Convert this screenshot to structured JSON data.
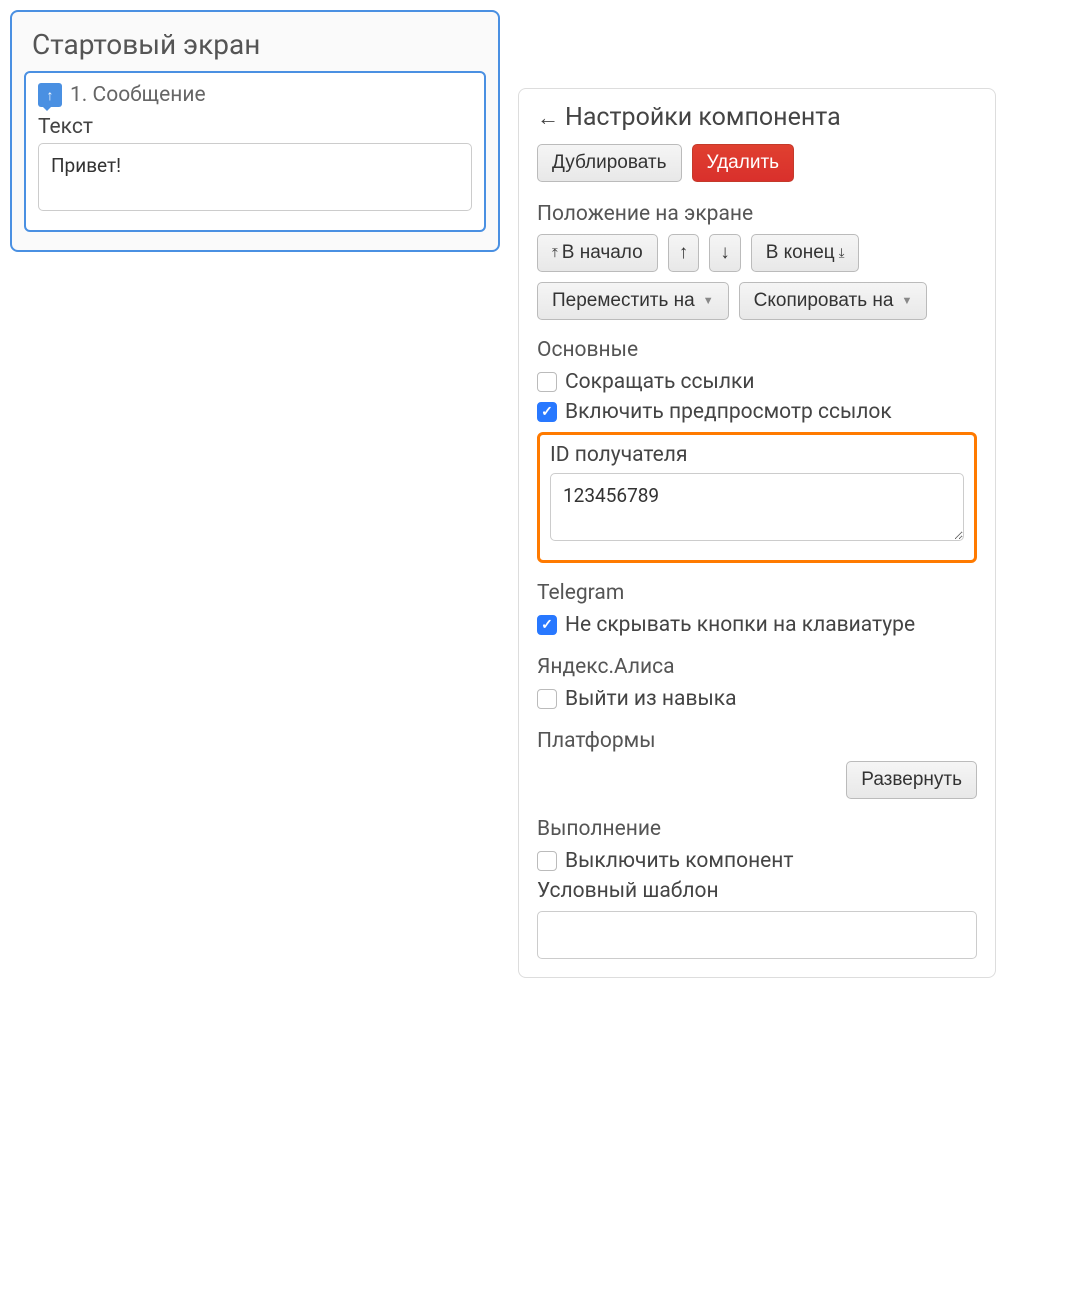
{
  "left": {
    "screen_title": "Стартовый экран",
    "component_title": "1. Сообщение",
    "text_label": "Текст",
    "text_value": "Привет!"
  },
  "settings": {
    "header": "Настройки компонента",
    "duplicate": "Дублировать",
    "delete": "Удалить",
    "position": {
      "title": "Положение на экране",
      "to_start": "В начало",
      "up": "↑",
      "down": "↓",
      "to_end": "В конец",
      "move_to": "Переместить на",
      "copy_to": "Скопировать на"
    },
    "main": {
      "title": "Основные",
      "shorten_links": "Сокращать ссылки",
      "shorten_links_checked": false,
      "enable_preview": "Включить предпросмотр ссылок",
      "enable_preview_checked": true,
      "recipient_id_label": "ID получателя",
      "recipient_id_value": "123456789"
    },
    "telegram": {
      "title": "Telegram",
      "keep_buttons": "Не скрывать кнопки на клавиатуре",
      "keep_buttons_checked": true
    },
    "alisa": {
      "title": "Яндекс.Алиса",
      "exit_skill": "Выйти из навыка",
      "exit_skill_checked": false
    },
    "platforms": {
      "title": "Платформы",
      "expand": "Развернуть"
    },
    "execution": {
      "title": "Выполнение",
      "disable_component": "Выключить компонент",
      "disable_component_checked": false,
      "template_label": "Условный шаблон",
      "template_value": ""
    }
  }
}
